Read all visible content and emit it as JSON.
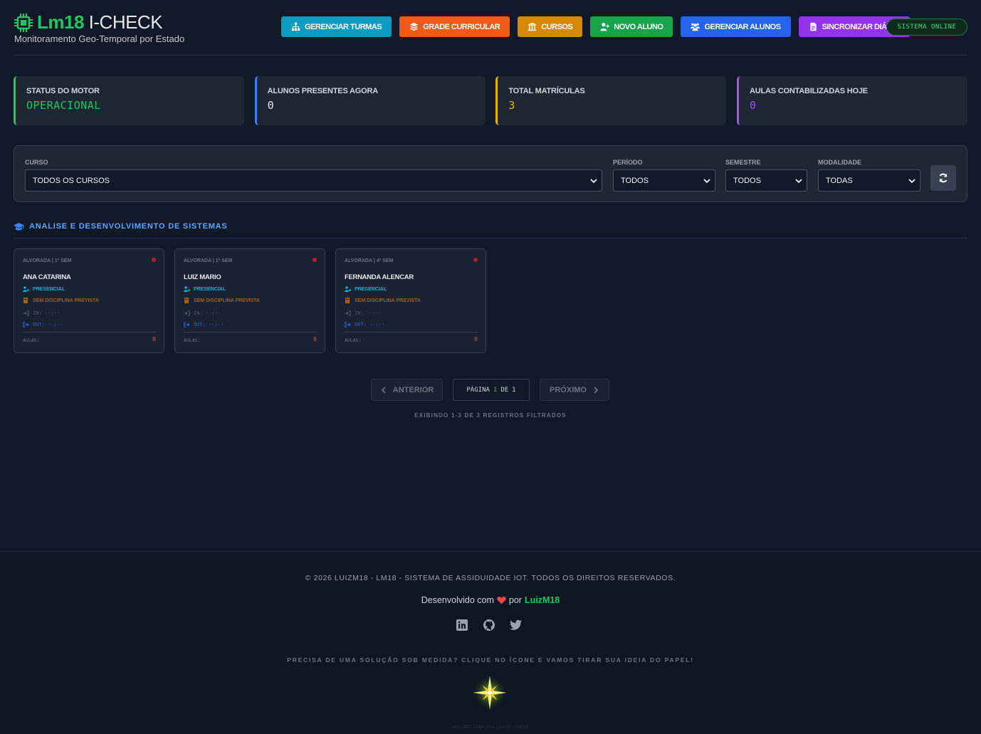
{
  "header": {
    "brand_bold": "Lm18",
    "brand_light": "I-CHECK",
    "subtitle": "Monitoramento Geo-Temporal por Estado",
    "status_badge": "SISTEMA ONLINE"
  },
  "nav": [
    {
      "label": "GERENCIAR TURMAS",
      "icon": "sitemap-icon",
      "color": "#0e9ac1"
    },
    {
      "label": "GRADE CURRICULAR",
      "icon": "layers-icon",
      "color": "#f05a16"
    },
    {
      "label": "CURSOS",
      "icon": "university-icon",
      "color": "#d48806"
    },
    {
      "label": "NOVO ALUNO",
      "icon": "user-plus-icon",
      "color": "#16a34a"
    },
    {
      "label": "GERENCIAR ALUNOS",
      "icon": "users-icon",
      "color": "#2563eb"
    },
    {
      "label": "SINCRONIZAR DIÁRIO",
      "icon": "file-icon",
      "color": "#9333ea"
    }
  ],
  "stats": [
    {
      "label": "STATUS DO MOTOR",
      "value": "OPERACIONAL",
      "color": "#22c55e"
    },
    {
      "label": "ALUNOS PRESENTES AGORA",
      "value": "0",
      "color": "#3b82f6"
    },
    {
      "label": "TOTAL MATRÍCULAS",
      "value": "3",
      "color": "#eab308"
    },
    {
      "label": "AULAS CONTABILIZADAS HOJE",
      "value": "0",
      "color": "#a855f7"
    }
  ],
  "filters": {
    "curso": {
      "label": "CURSO",
      "value": "TODOS OS CURSOS"
    },
    "periodo": {
      "label": "PERÍODO",
      "value": "TODOS"
    },
    "semestre": {
      "label": "SEMESTRE",
      "value": "TODOS"
    },
    "modalidade": {
      "label": "MODALIDADE",
      "value": "TODAS"
    }
  },
  "section": {
    "title": "ANALISE E DESENVOLVIMENTO DE SISTEMAS"
  },
  "students": [
    {
      "meta": "ALVORADA | 1º SEM",
      "name": "ANA CATARINA",
      "mode": "PRESENCIAL",
      "discipline": "SEM DISCIPLINA PREVISTA",
      "in": "IN: --:--",
      "out": "OUT: --:--",
      "aulas_label": "AULAS:",
      "aulas": "0"
    },
    {
      "meta": "ALVORADA | 1º SEM",
      "name": "LUIZ MARIO",
      "mode": "PRESENCIAL",
      "discipline": "SEM DISCIPLINA PREVISTA",
      "in": "IN: --:--",
      "out": "OUT: --:--",
      "aulas_label": "AULAS:",
      "aulas": "0"
    },
    {
      "meta": "ALVORADA | 4º SEM",
      "name": "FERNANDA ALENCAR",
      "mode": "PRESENCIAL",
      "discipline": "SEM DISCIPLINA PREVISTA",
      "in": "IN: --:--",
      "out": "OUT: --:--",
      "aulas_label": "AULAS:",
      "aulas": "0"
    }
  ],
  "pagination": {
    "prev": "ANTERIOR",
    "next": "PRÓXIMO",
    "page_word": "PÁGINA",
    "current": "1",
    "of_word": "DE",
    "total": "1",
    "showing": "EXIBINDO 1-3 DE 3 REGISTROS FILTRADOS"
  },
  "footer": {
    "copyright": "© 2026 LUIZM18 - LM18 - SISTEMA DE ASSIDUIDADE IOT. TODOS OS DIREITOS RESERVADOS.",
    "dev_prefix": "Desenvolvido com",
    "dev_by": "por",
    "author": "LuizM18",
    "cta": "PRECISA DE UMA SOLUÇÃO SOB MEDIDA? CLIQUE NO ÍCONE E VAMOS TIRAR SUA IDEIA DO PAPEL!",
    "version": "v8.0 GEO-TEMPORAL | Lm18 I-CHECK"
  }
}
